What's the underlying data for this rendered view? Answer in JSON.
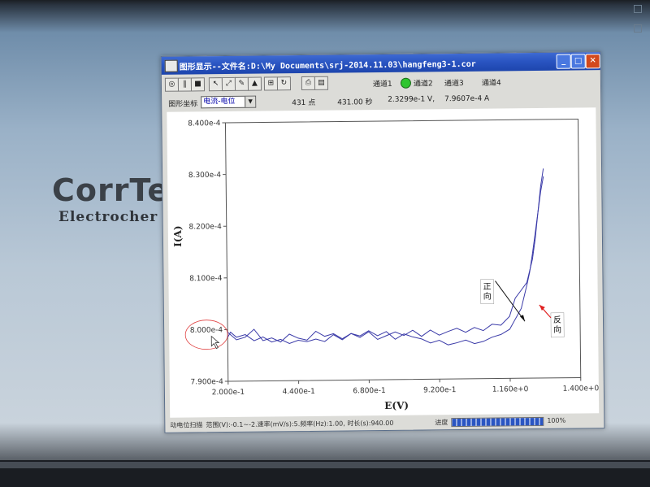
{
  "background": {
    "brand": "CorrTe",
    "brand_sub": "Electrocher"
  },
  "window": {
    "title": "图形显示--文件名:D:\\My Documents\\srj-2014.11.03\\hangfeng3-1.cor",
    "controls": {
      "minimize": "_",
      "maximize": "□",
      "close": "✕"
    }
  },
  "toolbar": {
    "channels": [
      "通道1",
      "通道2",
      "通道3",
      "通道4"
    ],
    "active_channel_color": "#2fc52f"
  },
  "infobar": {
    "type_label": "图形坐标",
    "type_value": "电流-电位",
    "points": "431 点",
    "time": "431.00 秒",
    "voltage": "2.3299e-1 V,",
    "current": "7.9607e-4 A"
  },
  "chart_data": {
    "type": "line",
    "xlabel": "E(V)",
    "ylabel": "I(A)",
    "xlim": [
      0.2,
      1.4
    ],
    "ylim": [
      0.00079,
      0.00084
    ],
    "x_ticks": [
      "2.000e-1",
      "4.400e-1",
      "6.800e-1",
      "9.200e-1",
      "1.160e+0",
      "1.400e+0"
    ],
    "y_ticks": [
      "8.400e-4",
      "8.300e-4",
      "8.200e-4",
      "8.100e-4",
      "8.000e-4",
      "7.900e-4"
    ],
    "line_color": "#3a3aa8",
    "annotations": [
      {
        "text": "正\n向",
        "arrow_color": "#111111"
      },
      {
        "text": "反\n向",
        "arrow_color": "#e02020"
      }
    ],
    "series": [
      {
        "x": [
          0.2,
          0.23,
          0.26,
          0.29,
          0.32,
          0.35,
          0.38,
          0.41,
          0.44,
          0.47,
          0.5,
          0.53,
          0.56,
          0.59,
          0.62,
          0.65,
          0.68,
          0.71,
          0.74,
          0.77,
          0.8,
          0.83,
          0.86,
          0.89,
          0.92,
          0.95,
          0.98,
          1.01,
          1.04,
          1.07,
          1.1,
          1.13,
          1.16,
          1.18,
          1.2,
          1.22,
          1.24,
          1.25,
          1.26,
          1.27,
          1.28
        ],
        "y": [
          0.0007995,
          0.000798,
          0.0007985,
          0.0008,
          0.0007978,
          0.0007983,
          0.0007975,
          0.000799,
          0.0007982,
          0.0007978,
          0.0007995,
          0.0007985,
          0.000799,
          0.000798,
          0.000799,
          0.0007982,
          0.0007993,
          0.0007978,
          0.0007985,
          0.0007992,
          0.0007985,
          0.0007995,
          0.0007983,
          0.0007995,
          0.0007985,
          0.0007992,
          0.0007998,
          0.000799,
          0.0007999,
          0.0007993,
          0.0008005,
          0.0008003,
          0.000802,
          0.0008055,
          0.000807,
          0.0008085,
          0.000813,
          0.000817,
          0.000822,
          0.000827,
          0.0008305
        ]
      },
      {
        "x": [
          1.28,
          1.27,
          1.26,
          1.25,
          1.24,
          1.23,
          1.22,
          1.2,
          1.18,
          1.16,
          1.13,
          1.1,
          1.07,
          1.04,
          1.01,
          0.98,
          0.95,
          0.92,
          0.89,
          0.86,
          0.83,
          0.8,
          0.77,
          0.74,
          0.71,
          0.68,
          0.65,
          0.62,
          0.59,
          0.56,
          0.53,
          0.5,
          0.47,
          0.44,
          0.41,
          0.38,
          0.35,
          0.32,
          0.29,
          0.26,
          0.23,
          0.21,
          0.2
        ],
        "y": [
          0.000829,
          0.000826,
          0.000822,
          0.000818,
          0.000814,
          0.0008105,
          0.000808,
          0.0008035,
          0.0008015,
          0.0007995,
          0.0007985,
          0.000798,
          0.0007972,
          0.0007968,
          0.0007975,
          0.000797,
          0.0007966,
          0.0007975,
          0.000797,
          0.0007978,
          0.0007982,
          0.0007988,
          0.0007978,
          0.0007993,
          0.0007985,
          0.0007995,
          0.0007985,
          0.000799,
          0.0007978,
          0.0007988,
          0.0007975,
          0.000798,
          0.0007975,
          0.0007978,
          0.0007972,
          0.000798,
          0.0007975,
          0.0007985,
          0.0007978,
          0.000799,
          0.0007985,
          0.0007995,
          0.0007985
        ]
      }
    ]
  },
  "status": {
    "mode": "动电位扫描",
    "params": "范围(V):-0.1~-2.速率(mV/s):5.频率(Hz):1.00, 时长(s):940.00",
    "progress_label": "进度",
    "progress": 100,
    "progress_text": "100%"
  }
}
